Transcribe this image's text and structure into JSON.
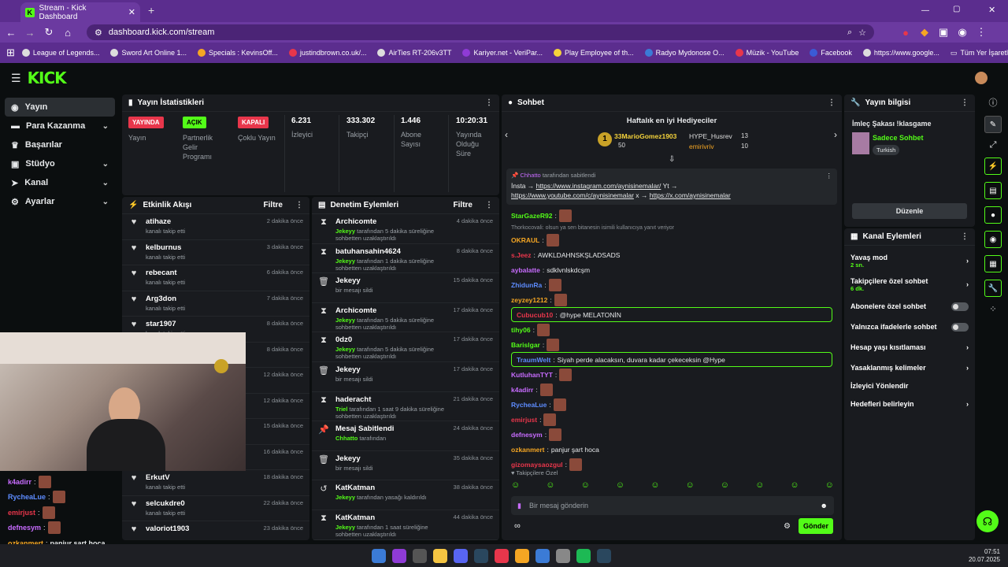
{
  "browser": {
    "tab_title": "Stream - Kick Dashboard",
    "url": "dashboard.kick.com/stream",
    "bookmarks": [
      "League of Legends...",
      "Sword Art Online 1...",
      "Specials : KevinsOff...",
      "justindbrown.co.uk/...",
      "AirTies RT-206v3TT",
      "Kariyer.net - VeriPar...",
      "Play Employee of th...",
      "Radyo Mydonose O...",
      "Müzik - YouTube",
      "Facebook",
      "https://www.google..."
    ],
    "all_bookmarks": "Tüm Yer İşaretleri"
  },
  "sidebar": {
    "items": [
      {
        "label": "Yayın"
      },
      {
        "label": "Para Kazanma"
      },
      {
        "label": "Başarılar"
      },
      {
        "label": "Stüdyo"
      },
      {
        "label": "Kanal"
      },
      {
        "label": "Ayarlar"
      }
    ]
  },
  "stats": {
    "title": "Yayın İstatistikleri",
    "live_badge": "YAYINDA",
    "live_label": "Yayın",
    "partner_badge": "AÇIK",
    "partner_label": "Partnerlik Gelir Programı",
    "multi_badge": "KAPALI",
    "multi_label": "Çoklu Yayın",
    "viewers": "6.231",
    "viewers_label": "İzleyici",
    "followers": "333.302",
    "followers_label": "Takipçi",
    "subs": "1.446",
    "subs_label": "Abone Sayısı",
    "uptime": "10:20:31",
    "uptime_label": "Yayında Olduğu Süre"
  },
  "activity": {
    "title": "Etkinlik Akışı",
    "filter": "Filtre",
    "rows": [
      {
        "name": "atihaze",
        "sub": "kanalı takip etti",
        "time": "2 dakika önce"
      },
      {
        "name": "kelburnus",
        "sub": "kanalı takip etti",
        "time": "3 dakika önce"
      },
      {
        "name": "rebecant",
        "sub": "kanalı takip etti",
        "time": "6 dakika önce"
      },
      {
        "name": "Arg3don",
        "sub": "kanalı takip etti",
        "time": "7 dakika önce"
      },
      {
        "name": "star1907",
        "sub": "kanalı takip etti",
        "time": "8 dakika önce"
      },
      {
        "name": "",
        "sub": "",
        "time": "8 dakika önce"
      },
      {
        "name": "",
        "sub": "",
        "time": "12 dakika önce"
      },
      {
        "name": "",
        "sub": "",
        "time": "12 dakika önce"
      },
      {
        "name": "",
        "sub": "",
        "time": "15 dakika önce"
      },
      {
        "name": "",
        "sub": "",
        "time": "16 dakika önce"
      },
      {
        "name": "ErkutV",
        "sub": "kanalı takip etti",
        "time": "18 dakika önce"
      },
      {
        "name": "selcukdre0",
        "sub": "kanalı takip etti",
        "time": "22 dakika önce"
      },
      {
        "name": "valoriot1903",
        "sub": "",
        "time": "23 dakika önce"
      }
    ]
  },
  "moderation": {
    "title": "Denetim Eylemleri",
    "filter": "Filtre",
    "rows": [
      {
        "icon": "⧗",
        "name": "Archicomte",
        "actor": "Jekeyy",
        "sub": "tarafından 5 dakika süreliğine sohbetten uzaklaştırıldı",
        "time": "4 dakika önce"
      },
      {
        "icon": "⧗",
        "name": "batuhansahin4624",
        "actor": "Jekeyy",
        "sub": "tarafından 1 dakika süreliğine sohbetten uzaklaştırıldı",
        "time": "8 dakika önce"
      },
      {
        "icon": "🗑",
        "name": "Jekeyy",
        "actor": "",
        "sub": "bir mesajı sildi",
        "time": "15 dakika önce"
      },
      {
        "icon": "⧗",
        "name": "Archicomte",
        "actor": "Jekeyy",
        "sub": "tarafından 5 dakika süreliğine sohbetten uzaklaştırıldı",
        "time": "17 dakika önce"
      },
      {
        "icon": "⧗",
        "name": "0dz0",
        "actor": "Jekeyy",
        "sub": "tarafından 5 dakika süreliğine sohbetten uzaklaştırıldı",
        "time": "17 dakika önce"
      },
      {
        "icon": "🗑",
        "name": "Jekeyy",
        "actor": "",
        "sub": "bir mesajı sildi",
        "time": "17 dakika önce"
      },
      {
        "icon": "⧗",
        "name": "haderacht",
        "actor": "Triel",
        "sub": "tarafından 1 saat 9 dakika süreliğine sohbetten uzaklaştırıldı",
        "time": "21 dakika önce"
      },
      {
        "icon": "📌",
        "name": "Mesaj Sabitlendi",
        "actor": "Chhatto",
        "sub": "tarafından",
        "time": "24 dakika önce"
      },
      {
        "icon": "🗑",
        "name": "Jekeyy",
        "actor": "",
        "sub": "bir mesajı sildi",
        "time": "35 dakika önce"
      },
      {
        "icon": "↺",
        "name": "KatKatman",
        "actor": "Jekeyy",
        "sub": "tarafından yasağı kaldırıldı",
        "time": "38 dakika önce"
      },
      {
        "icon": "⧗",
        "name": "KatKatman",
        "actor": "Jekeyy",
        "sub": "tarafından 1 saat süreliğine sohbetten uzaklaştırıldı",
        "time": "44 dakika önce"
      }
    ]
  },
  "chat": {
    "title": "Sohbet",
    "gifters_title": "Haftalık en iyi Hediyeciler",
    "gifter1": "33MarioGomez1903",
    "gifter1_count": "50",
    "gifter2": "HYPE_Husrev",
    "gifter2_count": "13",
    "gifter3": "emirivriv",
    "gifter3_count": "10",
    "pinned_by": "Chhatto",
    "pinned_suffix": "tarafından sabitlendi",
    "pinned_text1": "İnsta → ",
    "pinned_link1": "https://www.instagram.com/aynisinemalar/",
    "pinned_text2": " Yt →",
    "pinned_link2": "https://www.youtube.com/c/aynisinemalar",
    "pinned_text3": " x → ",
    "pinned_link3": "https://x.com/aynisinemalar",
    "reply_hint": "Thorkocovali: olsun ya sen bitanesin isimili kullanıcıya yanıt veriyor",
    "messages": [
      {
        "user": "StarGazeR92",
        "color": "#53fc18",
        "text": ""
      },
      {
        "user": "OKRAUL",
        "color": "#f5a623",
        "text": ""
      },
      {
        "user": "s.Jeez",
        "color": "#e8364b",
        "text": "AWKLDAHNSKŞLADSADS"
      },
      {
        "user": "aybalatte",
        "color": "#c86cff",
        "text": "sdklvnlskdcşm"
      },
      {
        "user": "ZhidunRa",
        "color": "#5d8cff",
        "text": ""
      },
      {
        "user": "zeyzey1212",
        "color": "#f5a623",
        "text": ""
      },
      {
        "user": "Cubucub10",
        "color": "#e8364b",
        "text": "@hype MELATONİN"
      },
      {
        "user": "tihy06",
        "color": "#53fc18",
        "text": ""
      },
      {
        "user": "Barislgar",
        "color": "#53fc18",
        "text": ""
      },
      {
        "user": "TraumWelt",
        "color": "#5d8cff",
        "text": "Siyah perde alacaksın, duvara kadar çekeceksin @Hype"
      },
      {
        "user": "KutluhanTYT",
        "color": "#c86cff",
        "text": ""
      },
      {
        "user": "k4adirr",
        "color": "#c86cff",
        "text": ""
      },
      {
        "user": "RycheaLue",
        "color": "#5d8cff",
        "text": ""
      },
      {
        "user": "emirjust",
        "color": "#e8364b",
        "text": ""
      },
      {
        "user": "defnesym",
        "color": "#c86cff",
        "text": ""
      },
      {
        "user": "ozkanmert",
        "color": "#f5a623",
        "text": "panjur şart hoca"
      },
      {
        "user": "gizomaysaozgul",
        "color": "#e8364b",
        "text": ""
      }
    ],
    "followers_only": "Takipçilere Özel",
    "placeholder": "Bir mesaj gönderin",
    "send": "Gönder"
  },
  "info": {
    "title": "Yayın bilgisi",
    "stream_title": "İmleç Şakası !klasgame",
    "category": "Sadece Sohbet",
    "tag": "Turkish",
    "edit": "Düzenle"
  },
  "actions": {
    "title": "Kanal Eylemleri",
    "slow": "Yavaş mod",
    "slow_val": "2 sn.",
    "followers": "Takipçilere özel sohbet",
    "followers_val": "6 dk.",
    "subs": "Abonelere özel sohbet",
    "emotes": "Yalnızca ifadelerle sohbet",
    "age": "Hesap yaşı kısıtlaması",
    "banned": "Yasaklanmış kelimeler",
    "redirect": "İzleyici Yönlendir",
    "goals": "Hedefleri belirleyin"
  },
  "overlay": {
    "lines": [
      {
        "user": "k4adirr",
        "color": "#c86cff",
        "text": ""
      },
      {
        "user": "RycheaLue",
        "color": "#5d8cff",
        "text": ""
      },
      {
        "user": "emirjust",
        "color": "#e8364b",
        "text": ""
      },
      {
        "user": "defnesym",
        "color": "#c86cff",
        "text": ""
      },
      {
        "user": "ozkanmert",
        "color": "#f5a623",
        "text": "panjur şart hoca"
      },
      {
        "user": "aozgul",
        "color": "#f5a623",
        "text": ""
      }
    ]
  },
  "taskbar": {
    "time": "07:51",
    "date": "20.07.2025"
  }
}
